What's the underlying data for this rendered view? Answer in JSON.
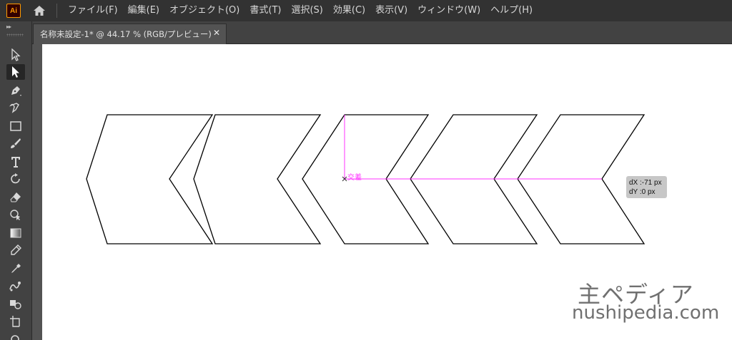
{
  "app": {
    "logo_text": "Ai",
    "brand_color": "#ff9a00"
  },
  "menu": {
    "items": [
      "ファイル(F)",
      "編集(E)",
      "オブジェクト(O)",
      "書式(T)",
      "選択(S)",
      "効果(C)",
      "表示(V)",
      "ウィンドウ(W)",
      "ヘルプ(H)"
    ]
  },
  "document_tab": {
    "title": "名称未設定-1* @ 44.17 % (RGB/プレビュー)",
    "close_glyph": "✕"
  },
  "toolbar": {
    "collapse_glyph": "▸▸",
    "tools": [
      {
        "name": "selection-tool",
        "icon": "arrow-outline-icon"
      },
      {
        "name": "direct-selection-tool",
        "icon": "arrow-filled-icon",
        "active": true
      },
      {
        "name": "pen-tool",
        "icon": "pen-icon"
      },
      {
        "name": "curvature-tool",
        "icon": "curvature-icon"
      },
      {
        "name": "rectangle-tool",
        "icon": "rectangle-icon"
      },
      {
        "name": "paintbrush-tool",
        "icon": "brush-icon"
      },
      {
        "name": "type-tool",
        "icon": "type-icon"
      },
      {
        "name": "rotate-tool",
        "icon": "rotate-icon"
      },
      {
        "name": "eraser-tool",
        "icon": "eraser-icon"
      },
      {
        "name": "shape-builder-tool",
        "icon": "shape-builder-icon"
      },
      {
        "name": "gradient-tool",
        "icon": "gradient-icon"
      },
      {
        "name": "eyedropper-alt-tool",
        "icon": "blend-icon"
      },
      {
        "name": "eyedropper-tool",
        "icon": "eyedropper-icon"
      },
      {
        "name": "puppet-warp-tool",
        "icon": "puppet-icon"
      },
      {
        "name": "live-paint-tool",
        "icon": "live-paint-icon"
      },
      {
        "name": "artboard-tool",
        "icon": "artboard-icon"
      },
      {
        "name": "zoom-tool",
        "icon": "zoom-icon"
      }
    ]
  },
  "canvas": {
    "smart_guide_label": "交差",
    "guide_color": "#ff33ff",
    "measure": {
      "dx": "dX :-71 px",
      "dy": "dY :0 px"
    }
  },
  "watermark": {
    "jp": "主ペディア",
    "en": "nushipedia.com"
  }
}
